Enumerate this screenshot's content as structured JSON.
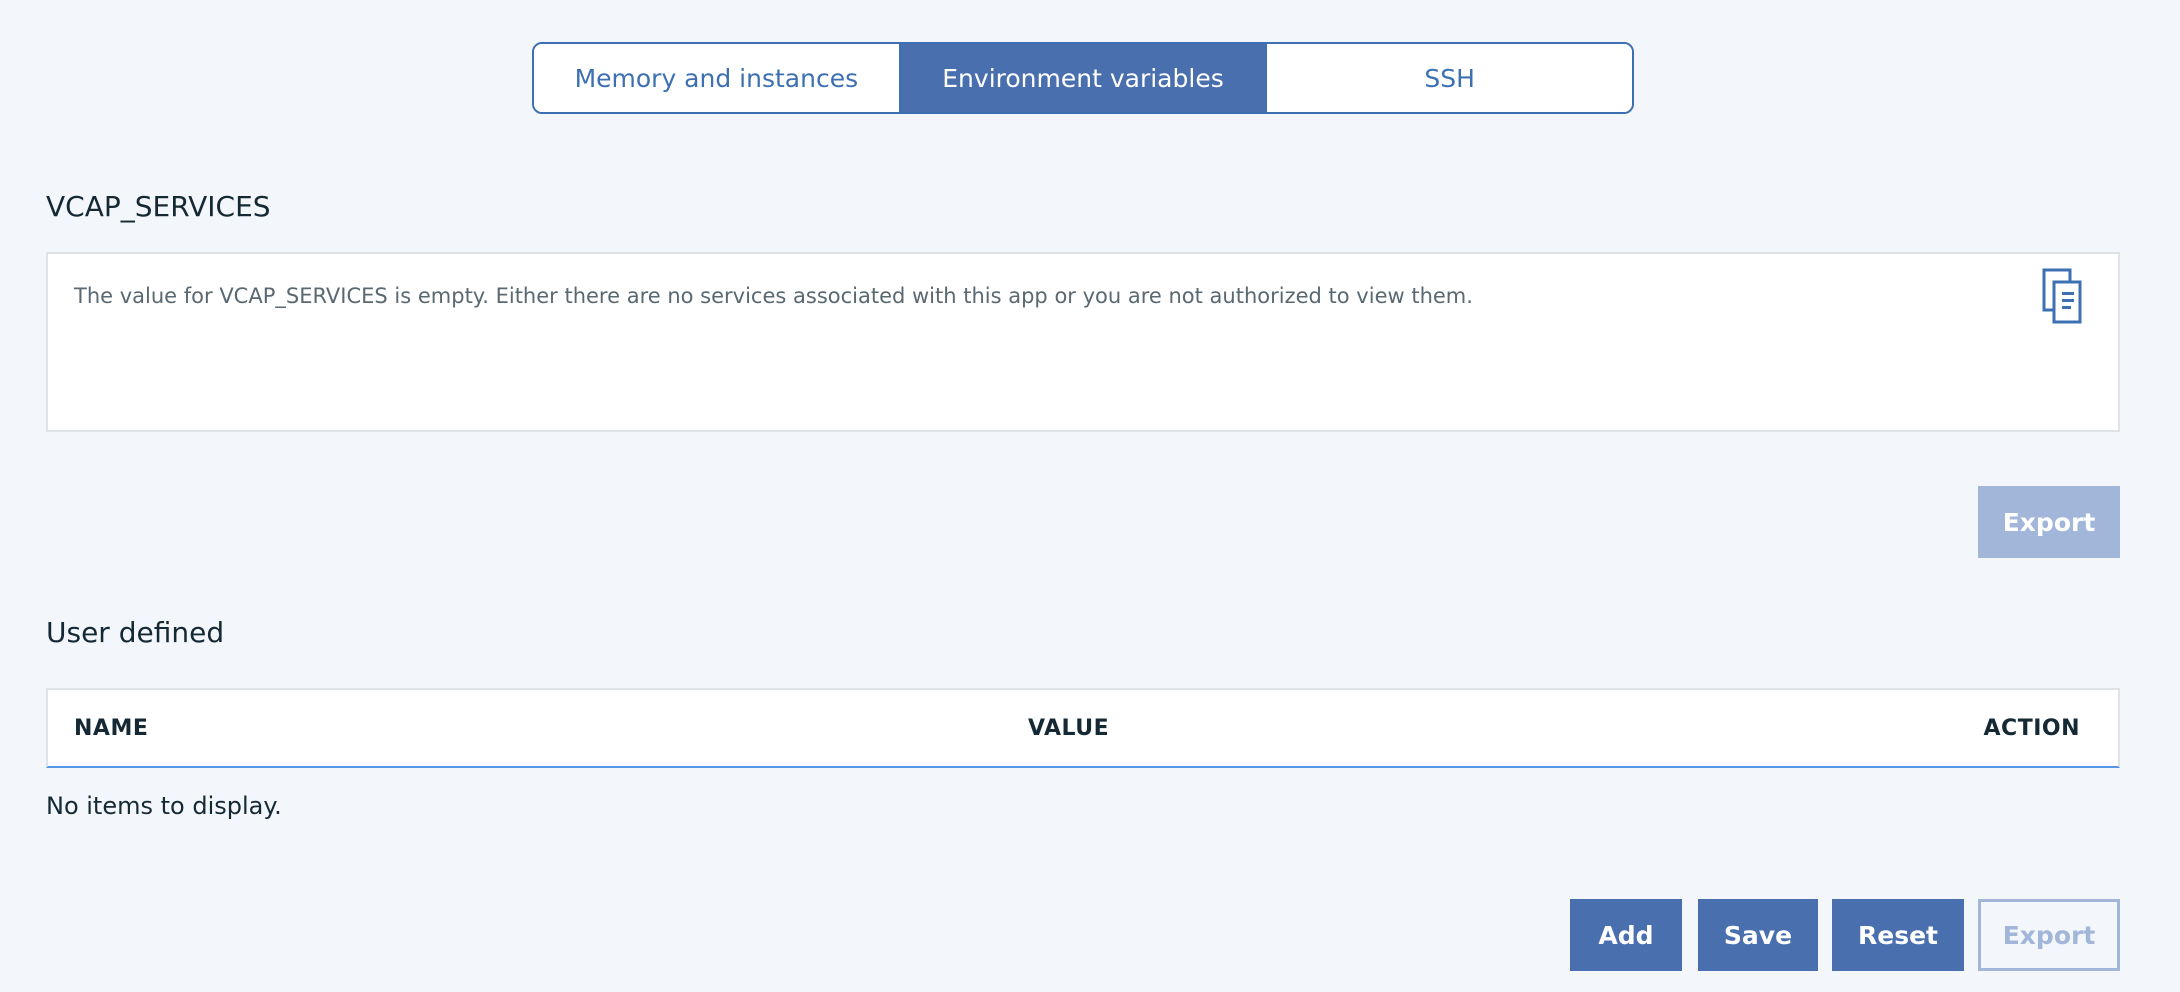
{
  "tabs": [
    {
      "label": "Memory and instances",
      "active": false
    },
    {
      "label": "Environment variables",
      "active": true
    },
    {
      "label": "SSH",
      "active": false
    }
  ],
  "vcap": {
    "title": "VCAP_SERVICES",
    "message": "The value for VCAP_SERVICES is empty. Either there are no services associated with this app or you are not authorized to view them.",
    "copy_icon": "copy-icon",
    "export_label": "Export"
  },
  "user_defined": {
    "title": "User defined",
    "columns": [
      "NAME",
      "VALUE",
      "ACTION"
    ],
    "empty_message": "No items to display."
  },
  "actions": {
    "add_label": "Add",
    "save_label": "Save",
    "reset_label": "Reset",
    "export_label": "Export"
  },
  "colors": {
    "accent": "#4a6fae",
    "disabled": "#a1b6d8",
    "background": "#f3f6fb"
  }
}
